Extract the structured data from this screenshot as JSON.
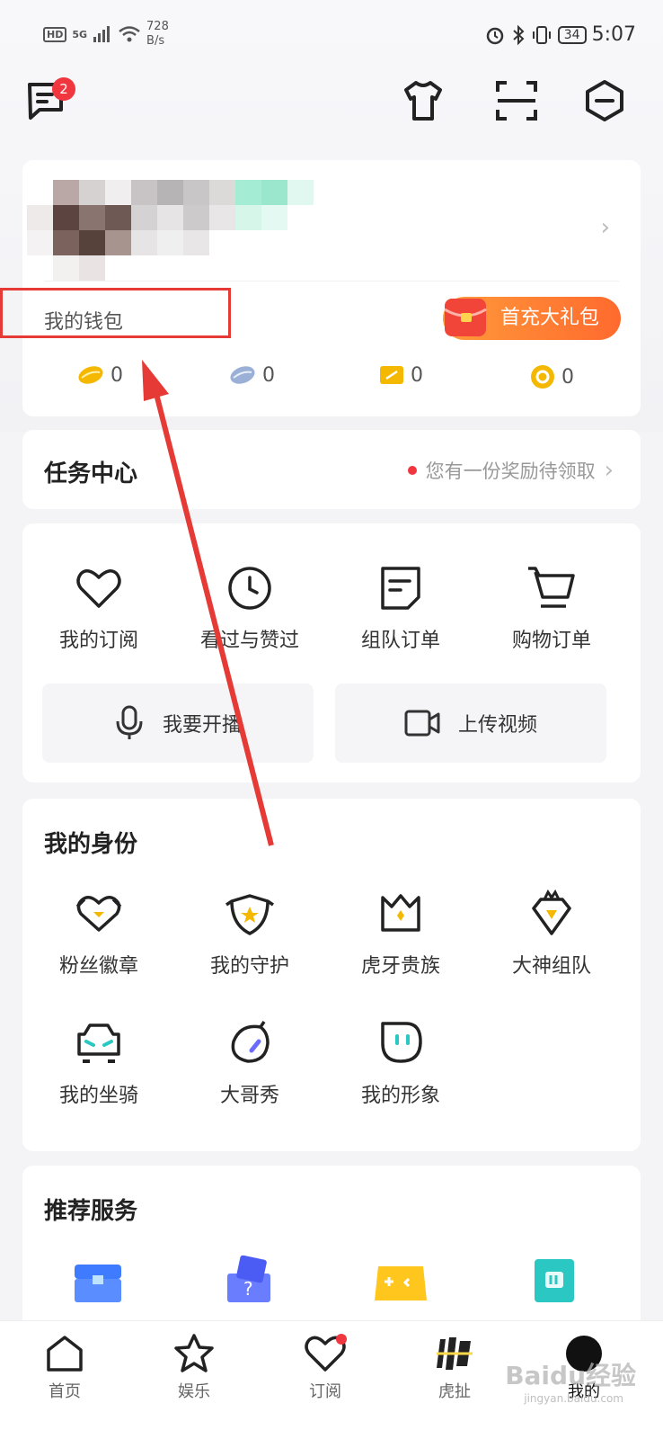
{
  "status_bar": {
    "hd": "HD",
    "net": "5G",
    "speed_value": "728",
    "speed_unit": "B/s",
    "battery": "34",
    "time": "5:07"
  },
  "header": {
    "message_badge": "2"
  },
  "wallet": {
    "label": "我的钱包",
    "gift_button": "首充大礼包",
    "balances": [
      "0",
      "0",
      "0",
      "0"
    ]
  },
  "task_center": {
    "title": "任务中心",
    "tip": "您有一份奖励待领取"
  },
  "orders": {
    "items": [
      {
        "label": "我的订阅",
        "icon": "heart-icon"
      },
      {
        "label": "看过与赞过",
        "icon": "clock-icon"
      },
      {
        "label": "组队订单",
        "icon": "note-icon"
      },
      {
        "label": "购物订单",
        "icon": "cart-icon"
      }
    ],
    "live_button": "我要开播",
    "upload_button": "上传视频"
  },
  "identity": {
    "title": "我的身份",
    "items": [
      {
        "label": "粉丝徽章",
        "icon": "fan-badge-icon"
      },
      {
        "label": "我的守护",
        "icon": "guard-shield-icon"
      },
      {
        "label": "虎牙贵族",
        "icon": "noble-crown-icon"
      },
      {
        "label": "大神组队",
        "icon": "master-team-icon"
      },
      {
        "label": "我的坐骑",
        "icon": "car-mount-icon"
      },
      {
        "label": "大哥秀",
        "icon": "big-brother-icon"
      },
      {
        "label": "我的形象",
        "icon": "avatar-face-icon"
      }
    ]
  },
  "services": {
    "title": "推荐服务"
  },
  "tabbar": {
    "tabs": [
      {
        "label": "首页",
        "icon": "home-icon"
      },
      {
        "label": "娱乐",
        "icon": "star-icon"
      },
      {
        "label": "订阅",
        "icon": "heart-icon"
      },
      {
        "label": "虎扯",
        "icon": "huche-icon"
      },
      {
        "label": "我的",
        "icon": "profile-icon"
      }
    ]
  },
  "watermark": {
    "text": "Baidu经验",
    "sub": "jingyan.baidu.com"
  },
  "colors": {
    "accent_orange": "#ff7a2e",
    "badge_red": "#f0363e",
    "annotation_red": "#e53a35",
    "coin_gold": "#f4b800"
  }
}
